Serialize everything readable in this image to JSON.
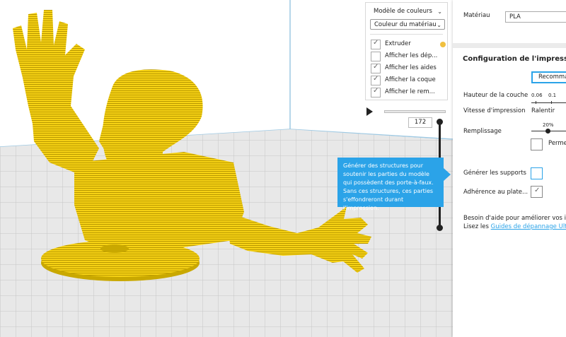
{
  "color_scheme": {
    "title": "Modèle de couleurs",
    "selected": "Couleur du matériau",
    "options": [
      {
        "label": "Extruder",
        "checked": true,
        "color": "#f0c040"
      },
      {
        "label": "Afficher les dép...",
        "checked": false
      },
      {
        "label": "Afficher les aides",
        "checked": true
      },
      {
        "label": "Afficher la coque",
        "checked": true
      },
      {
        "label": "Afficher le rem...",
        "checked": true
      }
    ]
  },
  "layer_view": {
    "current_layer": "172"
  },
  "tooltip": {
    "text": "Générer des structures pour soutenir les parties du modèle qui possèdent des porte-à-faux. Sans ces structures, ces parties s'effondreront durant l'impression."
  },
  "settings": {
    "material_label": "Matériau",
    "material_value": "PLA",
    "config_title": "Configuration de l'impression",
    "recommended_button": "Recomma",
    "layer_height_label": "Hauteur de la couche",
    "layer_height_values": [
      "0.06",
      "0.1"
    ],
    "print_speed_label": "Vitesse d'impression",
    "print_speed_value": "Ralentir",
    "infill_label": "Remplissage",
    "infill_value": "20%",
    "gradual_label": "Perme",
    "supports_label": "Générer les supports",
    "supports_checked": false,
    "adhesion_label": "Adhérence au plate...",
    "adhesion_checked": true,
    "help_line1": "Besoin d'aide pour améliorer vos impr",
    "help_line2_prefix": "Lisez les ",
    "help_link": "Guides de dépannage Ultima"
  },
  "colors": {
    "model_yellow": "#f5cf12",
    "accent_blue": "#2ba3e8",
    "build_plate": "#e8e8e8"
  }
}
